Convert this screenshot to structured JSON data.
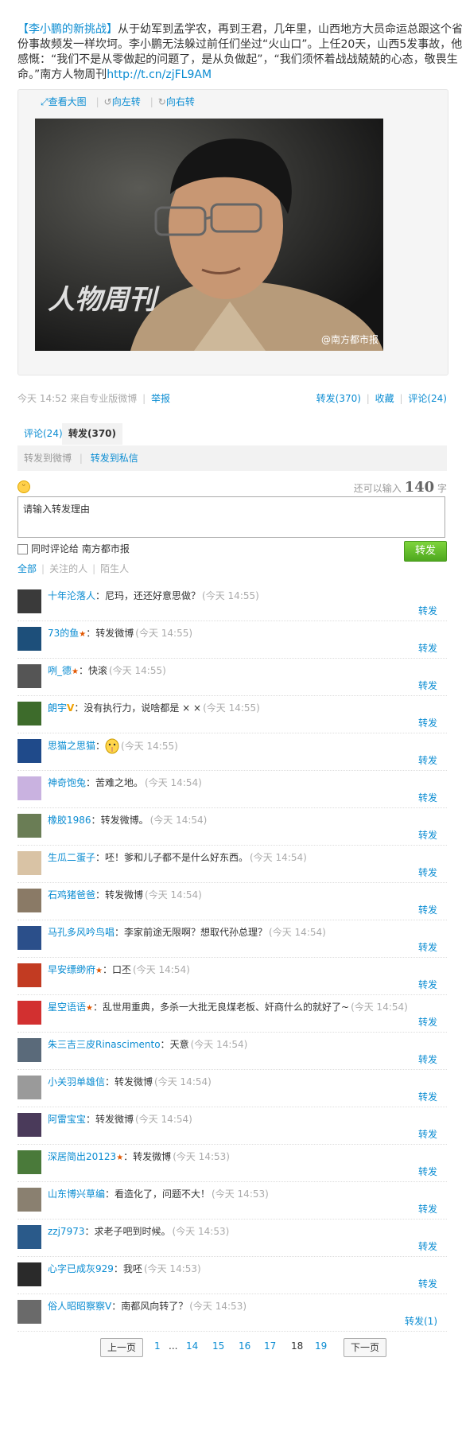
{
  "post": {
    "author": "【李小鹏的新挑战】",
    "text": "从于幼军到孟学农，再到王君，几年里，山西地方大员命运总跟这个省份事故频发一样坎坷。李小鹏无法躲过前任们坐过“火山口”。上任20天，山西5发事故，他感慨：“我们不是从零做起的问题了，是从负做起”，“我们须怀着战战兢兢的心态，敬畏生命。”南方人物周刊",
    "url": "http://t.cn/zjFL9AM"
  },
  "media_tools": {
    "view": "查看大图",
    "rotate_left": "向左转",
    "rotate_right": "向右转"
  },
  "photo": {
    "brand": "人物周刊",
    "watermark": "@南方都市报"
  },
  "meta": {
    "time": "今天 14:52",
    "source": "来自专业版微博",
    "report": "举报",
    "forward": "转发(370)",
    "favorite": "收藏",
    "comment": "评论(24)"
  },
  "tabs": {
    "comment": "评论(24)",
    "forward": "转发(370)"
  },
  "subtabs": {
    "to_weibo": "转发到微博",
    "to_private": "转发到私信"
  },
  "composer": {
    "remaining_label": "还可以输入",
    "remaining_num": "140",
    "remaining_unit": "字",
    "placeholder": "请输入转发理由",
    "also_comment": "同时评论给 南方都市报",
    "forward_btn": "转发"
  },
  "filters": {
    "all": "全部",
    "following": "关注的人",
    "strangers": "陌生人"
  },
  "forward_label": "转发",
  "forwards": [
    {
      "user": "十年沦落人",
      "text": "尼玛，还还好意思做？",
      "time": "(今天 14:55)",
      "color": "#3a3a3a"
    },
    {
      "user": "73的鱼",
      "vip": true,
      "text": "转发微博",
      "time": "(今天 14:55)",
      "color": "#1d4f7a"
    },
    {
      "user": "咧_德",
      "vip": true,
      "text": "快滚",
      "time": "(今天 14:55)",
      "color": "#555"
    },
    {
      "user": "朗宇",
      "v": true,
      "text": "没有执行力，说啥都是 ×  ×",
      "time": "(今天 14:55)",
      "color": "#3d6b2b"
    },
    {
      "user": "思猫之思猫",
      "emoji": true,
      "text": "",
      "time": "(今天 14:55)",
      "color": "#1f4a8a"
    },
    {
      "user": "神奇饱兔",
      "text": "苦难之地。",
      "time": "(今天 14:54)",
      "color": "#c9b2e0"
    },
    {
      "user": "橡胶1986",
      "text": "转发微博。",
      "time": "(今天 14:54)",
      "color": "#6a7d55"
    },
    {
      "user": "生瓜二蛋子",
      "text": "呸！爹和儿子都不是什么好东西。",
      "time": "(今天 14:54)",
      "color": "#d9c3a5"
    },
    {
      "user": "石鸡猪爸爸",
      "text": "转发微博",
      "time": "(今天 14:54)",
      "color": "#8a7a66"
    },
    {
      "user": "马孔多风吟鸟唱",
      "text": "李家前途无限啊？想取代孙总理？",
      "time": "(今天 14:54)",
      "color": "#2b4f8a"
    },
    {
      "user": "早安缥缈府",
      "vip": true,
      "text": "口丕",
      "time": "(今天 14:54)",
      "color": "#c23b22"
    },
    {
      "user": "星空语语",
      "vip": true,
      "text": "乱世用重典，多杀一大批无良煤老板、奸商什么的就好了~",
      "time": "(今天 14:54)",
      "color": "#d23030"
    },
    {
      "user": "朱三吉三皮Rinascimento",
      "text": "天意",
      "time": "(今天 14:54)",
      "color": "#5a6a7a"
    },
    {
      "user": "小关羽单雄信",
      "text": "转发微博",
      "time": "(今天 14:54)",
      "color": "#9a9a9a"
    },
    {
      "user": "阿雷宝宝",
      "text": "转发微博",
      "time": "(今天 14:54)",
      "color": "#4a3a5a"
    },
    {
      "user": "深居简出20123",
      "vip": true,
      "text": "转发微博",
      "time": "(今天 14:53)",
      "color": "#4a7a3a"
    },
    {
      "user": "山东博兴草编",
      "text": "看造化了，问题不大！",
      "time": "(今天 14:53)",
      "color": "#8a8070"
    },
    {
      "user": "zzj7973",
      "text": "求老子吧到时候。",
      "time": "(今天 14:53)",
      "color": "#2a5a8a"
    },
    {
      "user": "心字已成灰929",
      "text": "我呸",
      "time": "(今天 14:53)",
      "color": "#2a2a2a"
    },
    {
      "user": "俗人昭昭察察V",
      "text": "南都风向转了？",
      "time": "(今天 14:53)",
      "color": "#6a6a6a",
      "fwd_label": "转发(1)"
    }
  ],
  "pager": {
    "prev": "上一页",
    "next": "下一页",
    "pages": [
      "1",
      "...",
      "14",
      "15",
      "16",
      "17",
      "18",
      "19"
    ],
    "current": "18"
  }
}
